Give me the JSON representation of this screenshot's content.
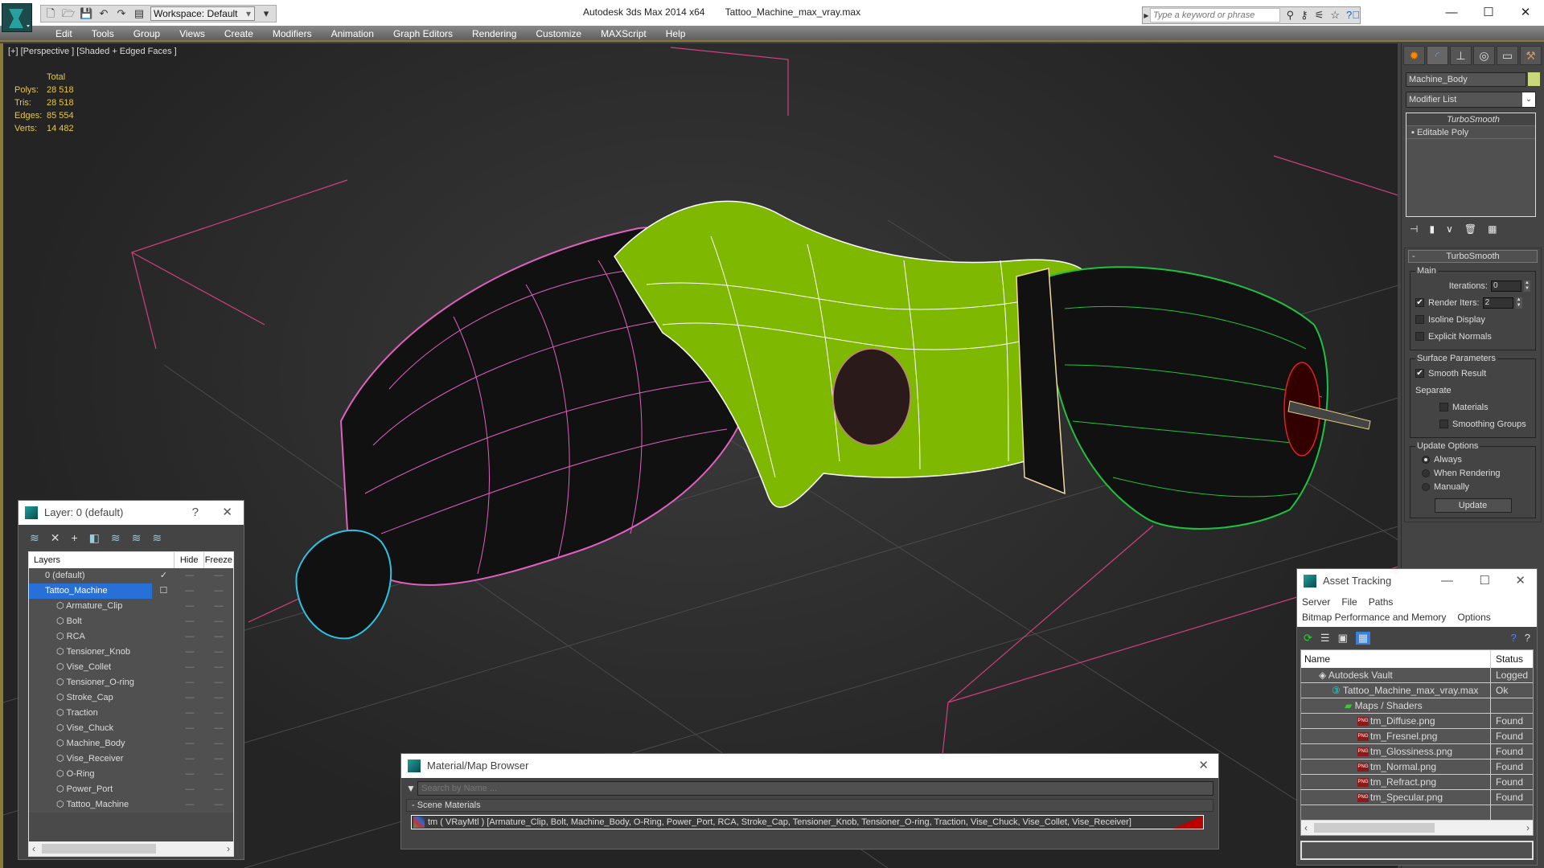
{
  "app": {
    "title": "Autodesk 3ds Max  2014 x64",
    "file": "Tattoo_Machine_max_vray.max",
    "workspace": "Workspace: Default",
    "search_placeholder": "Type a keyword or phrase",
    "window_buttons": {
      "minimize": "—",
      "maximize": "☐",
      "close": "✕"
    }
  },
  "menu": [
    "Edit",
    "Tools",
    "Group",
    "Views",
    "Create",
    "Modifiers",
    "Animation",
    "Graph Editors",
    "Rendering",
    "Customize",
    "MAXScript",
    "Help"
  ],
  "viewport": {
    "label": "[+] [Perspective ] [Shaded + Edged Faces ]",
    "stats": {
      "header": "Total",
      "rows": [
        {
          "k": "Polys:",
          "v": "28 518"
        },
        {
          "k": "Tris:",
          "v": "28 518"
        },
        {
          "k": "Edges:",
          "v": "85 554"
        },
        {
          "k": "Verts:",
          "v": "14 482"
        }
      ]
    },
    "colors": {
      "body": "#7fb800",
      "wire_body": "#ffffff",
      "pink": "#e060c0",
      "cyan": "#30c0e0",
      "green": "#20c040",
      "grid_pink": "#d04080"
    }
  },
  "command_panel": {
    "object_name": "Machine_Body",
    "object_color": "#c8d87a",
    "modifier_list": "Modifier List",
    "stack": [
      "TurboSmooth",
      "Editable Poly"
    ],
    "rollout": {
      "title": "TurboSmooth",
      "main_label": "Main",
      "iterations_label": "Iterations:",
      "iterations": "0",
      "render_iters_label": "Render Iters:",
      "render_iters": "2",
      "isoline": "Isoline Display",
      "explicit_normals": "Explicit Normals",
      "surface_label": "Surface Parameters",
      "smooth_result": "Smooth Result",
      "separate": "Separate",
      "materials": "Materials",
      "smoothing_groups": "Smoothing Groups",
      "update_label": "Update Options",
      "always": "Always",
      "when_rendering": "When Rendering",
      "manually": "Manually",
      "update_button": "Update"
    }
  },
  "layer_window": {
    "title": "Layer: 0 (default)",
    "help": "?",
    "close": "✕",
    "columns": {
      "layers": "Layers",
      "hide": "Hide",
      "freeze": "Freeze"
    },
    "default_layer": "0 (default)",
    "selected_layer": "Tattoo_Machine",
    "objects": [
      "Armature_Clip",
      "Bolt",
      "RCA",
      "Tensioner_Knob",
      "Vise_Collet",
      "Tensioner_O-ring",
      "Stroke_Cap",
      "Traction",
      "Vise_Chuck",
      "Machine_Body",
      "Vise_Receiver",
      "O-Ring",
      "Power_Port",
      "Tattoo_Machine"
    ]
  },
  "material_browser": {
    "title": "Material/Map Browser",
    "search_placeholder": "Search by Name ...",
    "section": "- Scene Materials",
    "item": "tm  ( VRayMtl ) [Armature_Clip, Bolt, Machine_Body, O-Ring, Power_Port, RCA, Stroke_Cap, Tensioner_Knob, Tensioner_O-ring, Traction, Vise_Chuck, Vise_Collet, Vise_Receiver]"
  },
  "asset_tracking": {
    "title": "Asset Tracking",
    "menu1": [
      "Server",
      "File",
      "Paths"
    ],
    "menu2": [
      "Bitmap Performance and Memory",
      "Options"
    ],
    "columns": {
      "name": "Name",
      "status": "Status"
    },
    "rows": [
      {
        "name": "Autodesk Vault",
        "status": "Logged Out",
        "indent": 0
      },
      {
        "name": "Tattoo_Machine_max_vray.max",
        "status": "Ok",
        "indent": 1
      },
      {
        "name": "Maps / Shaders",
        "status": "",
        "indent": 2
      },
      {
        "name": "tm_Diffuse.png",
        "status": "Found",
        "indent": 3
      },
      {
        "name": "tm_Fresnel.png",
        "status": "Found",
        "indent": 3
      },
      {
        "name": "tm_Glossiness.png",
        "status": "Found",
        "indent": 3
      },
      {
        "name": "tm_Normal.png",
        "status": "Found",
        "indent": 3
      },
      {
        "name": "tm_Refract.png",
        "status": "Found",
        "indent": 3
      },
      {
        "name": "tm_Specular.png",
        "status": "Found",
        "indent": 3
      }
    ]
  }
}
